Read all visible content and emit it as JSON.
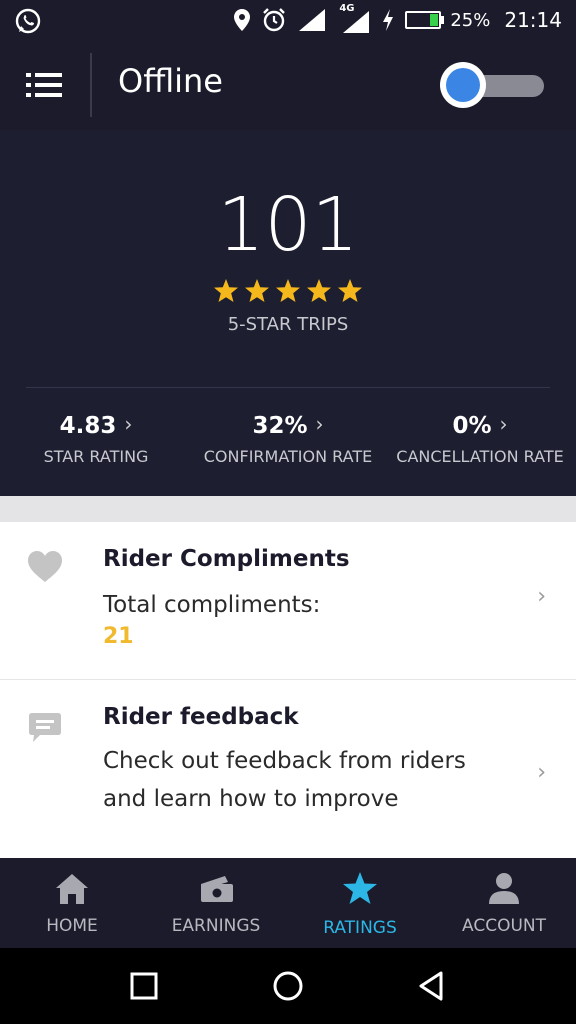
{
  "status_bar": {
    "battery_percent": "25%",
    "battery_level": 0.25,
    "network_label": "4G",
    "time": "21:14",
    "icons": [
      "whatsapp-icon",
      "location-icon",
      "alarm-icon",
      "signal-icon",
      "lte-signal-icon",
      "charging-icon",
      "battery-icon"
    ]
  },
  "app_bar": {
    "title": "Offline",
    "menu_icon": "menu-icon",
    "online_toggle": {
      "on": false,
      "knob_color": "#3b86e4"
    }
  },
  "stats": {
    "five_star_trips": "101",
    "stars_count": 5,
    "star_color": "#f5b81c",
    "caption": "5-STAR TRIPS",
    "metrics": [
      {
        "value": "4.83",
        "label": "STAR RATING"
      },
      {
        "value": "32%",
        "label": "CONFIRMATION RATE"
      },
      {
        "value": "0%",
        "label": "CANCELLATION RATE"
      }
    ]
  },
  "cards": [
    {
      "icon": "heart-icon",
      "title": "Rider Compliments",
      "text": "Total compliments:",
      "count": "21",
      "count_color": "#f0b92e"
    },
    {
      "icon": "speech-bubble-icon",
      "title": "Rider feedback",
      "text": "Check out feedback from riders and learn how to improve"
    }
  ],
  "bottom_nav": {
    "active_index": 2,
    "active_color": "#2cb7e6",
    "items": [
      {
        "label": "HOME",
        "icon": "home-icon"
      },
      {
        "label": "EARNINGS",
        "icon": "earnings-icon"
      },
      {
        "label": "RATINGS",
        "icon": "star-icon"
      },
      {
        "label": "ACCOUNT",
        "icon": "account-icon"
      }
    ]
  },
  "system_nav": {
    "icons": [
      "recents-icon",
      "home-circle-icon",
      "back-icon"
    ]
  }
}
